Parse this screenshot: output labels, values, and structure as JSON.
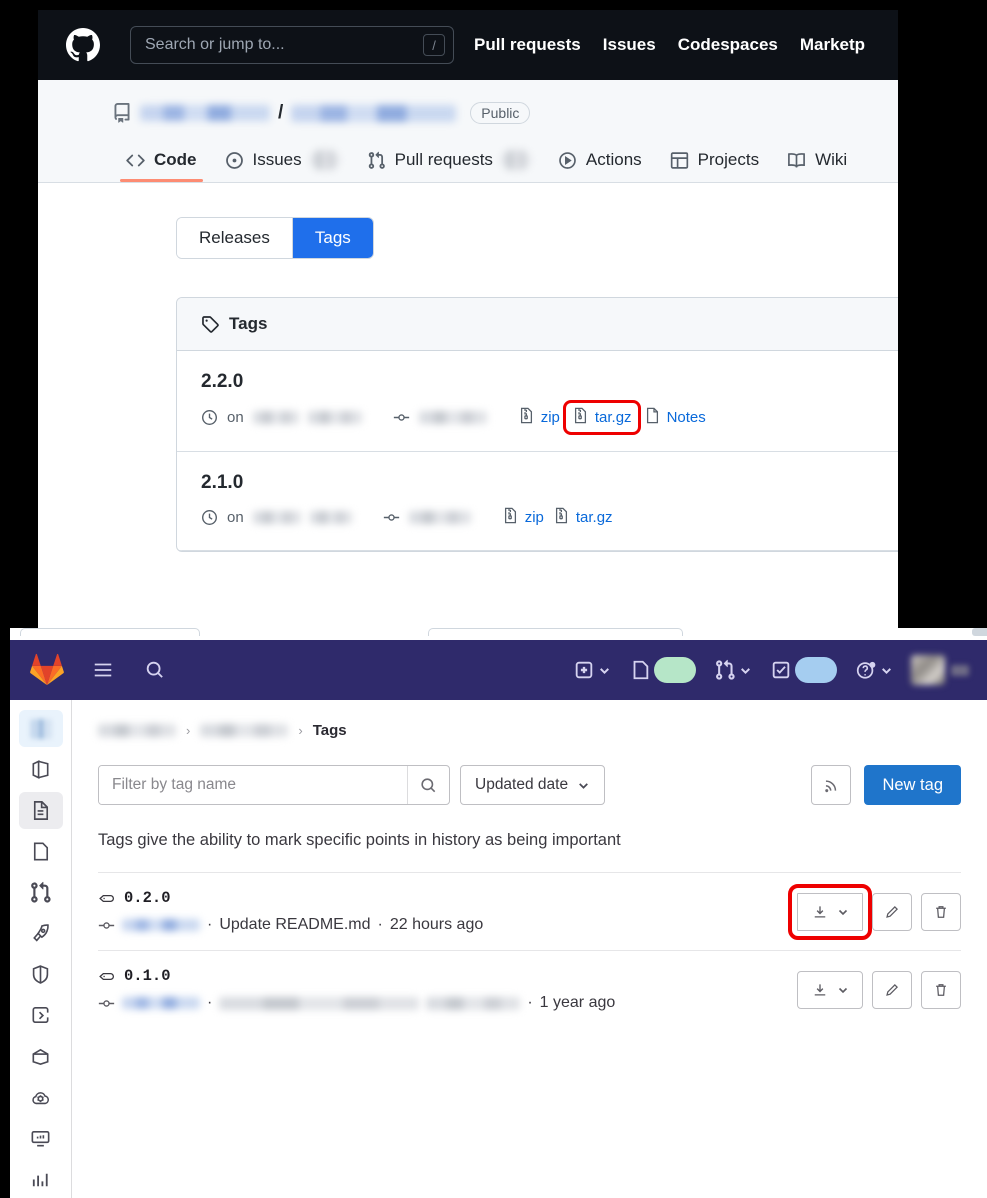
{
  "github": {
    "header": {
      "logo_icon": "github-mark-icon",
      "search_placeholder": "Search or jump to...",
      "search_shortcut": "/",
      "nav": [
        {
          "label": "Pull requests"
        },
        {
          "label": "Issues"
        },
        {
          "label": "Codespaces"
        },
        {
          "label": "Marketp"
        }
      ]
    },
    "repo": {
      "owner_redacted": true,
      "name_redacted": true,
      "separator": "/",
      "visibility": "Public",
      "repo_icon": "repo-book-icon"
    },
    "tabs": [
      {
        "label": "Code",
        "icon": "code-brackets-icon",
        "active": true,
        "count": null
      },
      {
        "label": "Issues",
        "icon": "issue-opened-icon",
        "active": false,
        "count_redacted": true
      },
      {
        "label": "Pull requests",
        "icon": "git-pull-request-icon",
        "active": false,
        "count_redacted": true
      },
      {
        "label": "Actions",
        "icon": "play-circle-icon",
        "active": false,
        "count": null
      },
      {
        "label": "Projects",
        "icon": "table-grid-icon",
        "active": false,
        "count": null
      },
      {
        "label": "Wiki",
        "icon": "book-icon",
        "active": false,
        "count": null
      }
    ],
    "segmented": {
      "releases_label": "Releases",
      "tags_label": "Tags",
      "selected": "Tags",
      "selected_color": "#1f6feb"
    },
    "card": {
      "title": "Tags",
      "title_icon": "tag-icon",
      "rows": [
        {
          "name": "2.2.0",
          "clock_icon": "clock-icon",
          "on_label": "on",
          "date_redacted": true,
          "commit_icon": "git-commit-icon",
          "commit_redacted": true,
          "downloads": [
            {
              "label": "zip",
              "icon": "file-zip-icon",
              "highlighted": false
            },
            {
              "label": "tar.gz",
              "icon": "file-zip-icon",
              "highlighted": true
            },
            {
              "label": "Notes",
              "icon": "file-icon",
              "highlighted": false
            }
          ]
        },
        {
          "name": "2.1.0",
          "clock_icon": "clock-icon",
          "on_label": "on",
          "date_redacted": true,
          "commit_icon": "git-commit-icon",
          "commit_redacted": true,
          "downloads": [
            {
              "label": "zip",
              "icon": "file-zip-icon",
              "highlighted": false
            },
            {
              "label": "tar.gz",
              "icon": "file-zip-icon",
              "highlighted": false
            }
          ]
        }
      ]
    },
    "highlight_color": "#ee0000"
  },
  "gitlab": {
    "topbar": {
      "logo_icon": "gitlab-fox-icon",
      "menu_icon": "hamburger-menu-icon",
      "search_icon": "search-icon",
      "right_items": [
        {
          "name": "create-new-dropdown",
          "icon": "plus-square-icon",
          "has_chevron": true
        },
        {
          "name": "issues-indicator",
          "icon": "issues-icon",
          "badge_color": "#b6e6c8",
          "has_chevron": false
        },
        {
          "name": "merge-requests-dropdown",
          "icon": "merge-request-icon",
          "has_chevron": true
        },
        {
          "name": "todos-indicator",
          "icon": "todo-check-icon",
          "badge_color": "#a5cdf0",
          "has_chevron": false
        },
        {
          "name": "help-dropdown",
          "icon": "question-circle-icon",
          "has_chevron": true
        },
        {
          "name": "user-avatar",
          "icon": "avatar-icon",
          "redacted": true
        }
      ]
    },
    "sidebar": [
      {
        "name": "project-avatar",
        "icon": "project-avatar-icon",
        "state": "project"
      },
      {
        "name": "project-overview",
        "icon": "cube-icon",
        "state": ""
      },
      {
        "name": "repository",
        "icon": "document-icon",
        "state": "active"
      },
      {
        "name": "issues",
        "icon": "issues-icon",
        "state": ""
      },
      {
        "name": "merge-requests",
        "icon": "merge-request-icon",
        "state": ""
      },
      {
        "name": "deployments",
        "icon": "rocket-icon",
        "state": ""
      },
      {
        "name": "security-compliance",
        "icon": "shield-icon",
        "state": ""
      },
      {
        "name": "ci-cd",
        "icon": "pipeline-icon",
        "state": ""
      },
      {
        "name": "packages-registries",
        "icon": "package-icon",
        "state": ""
      },
      {
        "name": "infrastructure",
        "icon": "cloud-gear-icon",
        "state": ""
      },
      {
        "name": "monitor",
        "icon": "monitor-icon",
        "state": ""
      },
      {
        "name": "analytics",
        "icon": "chart-bars-icon",
        "state": ""
      }
    ],
    "breadcrumbs": [
      {
        "label": "",
        "redacted": true
      },
      {
        "label": "",
        "redacted": true
      },
      {
        "label": "Tags",
        "redacted": false
      }
    ],
    "breadcrumb_separator": "›",
    "toolbar": {
      "filter_placeholder": "Filter by tag name",
      "filter_value": "",
      "search_icon": "search-icon",
      "sort_label": "Updated date",
      "sort_chevron_icon": "chevron-down-icon",
      "rss_icon": "rss-feed-icon",
      "new_tag_label": "New tag",
      "new_tag_color": "#1f75cb"
    },
    "description": "Tags give the ability to mark specific points in history as being important",
    "tags": [
      {
        "name": "0.2.0",
        "tag_icon": "tag-icon",
        "commit_icon": "git-commit-icon",
        "author_redacted": true,
        "separator": "·",
        "message": "Update README.md",
        "time": "22 hours ago",
        "actions": [
          {
            "name": "download-dropdown",
            "icon": "download-icon",
            "has_chevron": true,
            "highlighted": true
          },
          {
            "name": "edit-tag",
            "icon": "pencil-icon",
            "has_chevron": false,
            "highlighted": false
          },
          {
            "name": "delete-tag",
            "icon": "trash-icon",
            "has_chevron": false,
            "highlighted": false
          }
        ]
      },
      {
        "name": "0.1.0",
        "tag_icon": "tag-icon",
        "commit_icon": "git-commit-icon",
        "author_redacted": true,
        "separator": "·",
        "message_redacted": true,
        "time": "1 year ago",
        "actions": [
          {
            "name": "download-dropdown",
            "icon": "download-icon",
            "has_chevron": true,
            "highlighted": false
          },
          {
            "name": "edit-tag",
            "icon": "pencil-icon",
            "has_chevron": false,
            "highlighted": false
          },
          {
            "name": "delete-tag",
            "icon": "trash-icon",
            "has_chevron": false,
            "highlighted": false
          }
        ]
      }
    ],
    "highlight_color": "#ee0000"
  }
}
